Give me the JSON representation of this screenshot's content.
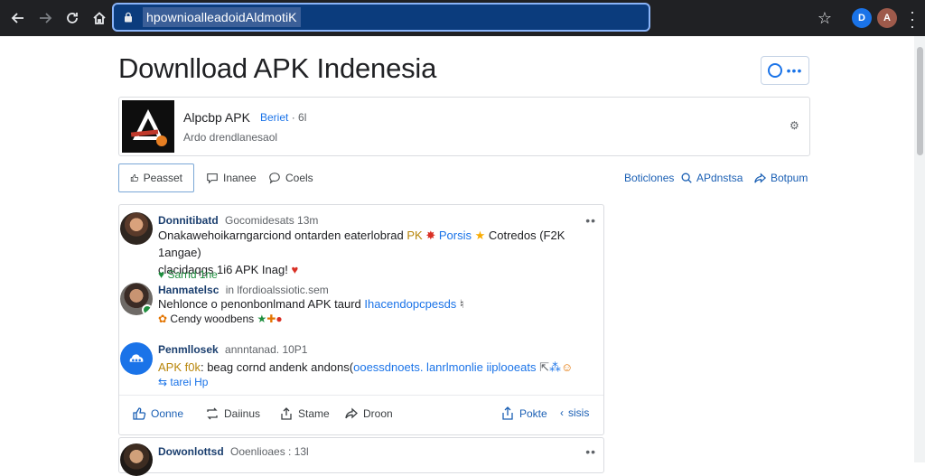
{
  "browser": {
    "url": "hpownioalleadoidAldmotiK",
    "ext1_letter": "D",
    "ext2_letter": "A"
  },
  "page": {
    "title": "Downlload APK Indenesia",
    "more_dots": "•••"
  },
  "app": {
    "name": "Alpcbp APK",
    "meta_link": "Beriet",
    "meta_extra": "· 6l",
    "subtitle": "Ardo drendlanesaol"
  },
  "tabs": [
    {
      "label": "Peasset"
    },
    {
      "label": "Inanee"
    },
    {
      "label": "Coels"
    }
  ],
  "right_links": [
    {
      "label": "Boticlones"
    },
    {
      "label": "APdnstsa"
    },
    {
      "label": "Botpum"
    }
  ],
  "posts": [
    {
      "author": "Donnitibatd",
      "meta": "Gocomidesats 13m",
      "text_a": "Onakawehoikarngarciond ontarden eaterlobrad ",
      "tag": "PK",
      "link": " Porsis ",
      "text_b": "Cotredos (F2K 1angae)",
      "line2": "clacidaqgs 1i6 APK Inag! ",
      "sub": "Sarnd 1ne"
    },
    {
      "author": "Hanmatelsc",
      "meta": "in lfordioalssiotic.sem",
      "text_a": "Nehlonce o penonbonlmand APK taurd ",
      "link": "Ihacendopcpesds",
      "text_b": " ♮",
      "sub": "Cendy woodbens"
    },
    {
      "author": "Penmllosek",
      "meta": "annntanad. 10P1",
      "tag": "APK f0k",
      "text_a": ": beag cornd andenk andons(",
      "link": "ooessdnoets. lanrlmonlie iiplooeats",
      "sub": "tarei Hp"
    },
    {
      "author": "Dowonlottsd",
      "meta": "Ooenlioaes : 13l"
    }
  ],
  "actions": [
    {
      "label": "Oonne"
    },
    {
      "label": "Daiinus"
    },
    {
      "label": "Stame"
    },
    {
      "label": "Droon"
    },
    {
      "label": "Pokte"
    },
    {
      "label": "sisis"
    }
  ]
}
